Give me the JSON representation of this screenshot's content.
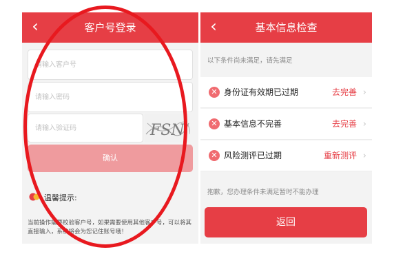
{
  "login": {
    "title": "客户号登录",
    "customer_placeholder": "请输入客户号",
    "password_placeholder": "请输入密码",
    "captcha_placeholder": "请输入验证码",
    "captcha_text": "FSN",
    "confirm_label": "确认",
    "tips_title": "温馨提示:",
    "tips_text": "当前操作需要校验客户号，如果需要使用其他客户号，可以将其直接输入，系统将会为您记住账号哦！"
  },
  "check": {
    "title": "基本信息检查",
    "intro": "以下条件尚未满足，请先满足",
    "items": [
      {
        "label": "身份证有效期已过期",
        "action": "去完善"
      },
      {
        "label": "基本信息不完善",
        "action": "去完善"
      },
      {
        "label": "风险测评已过期",
        "action": "重新测评"
      }
    ],
    "sorry": "抱歉，您办理条件未满足暂时不能办理",
    "back_label": "返回"
  },
  "colors": {
    "brand_red": "#e63e45",
    "annotation_red": "#e8191f"
  }
}
